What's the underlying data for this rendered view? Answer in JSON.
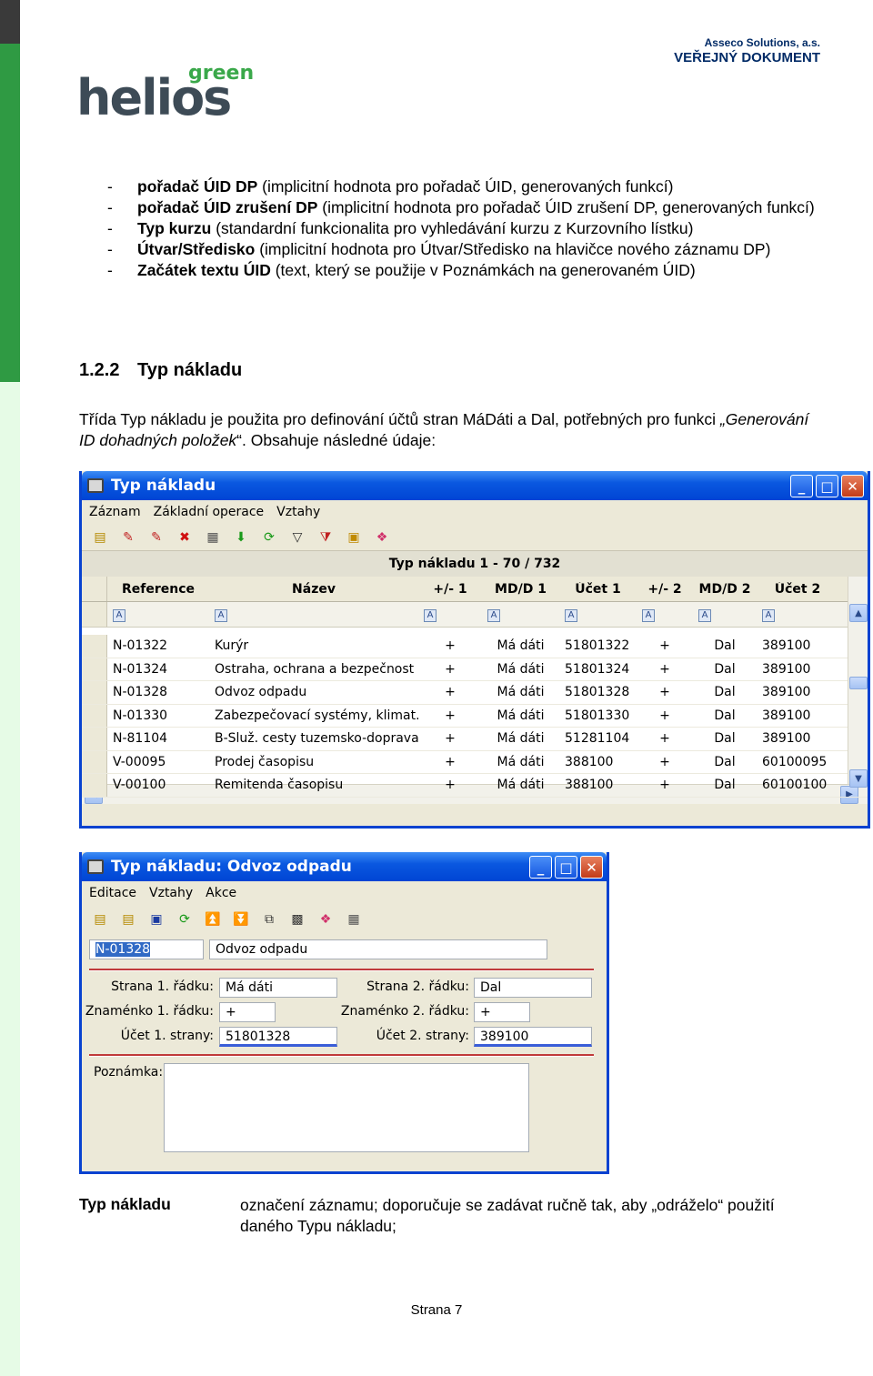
{
  "header": {
    "company": "Asseco Solutions, a.s.",
    "doc_type": "VEŘEJNÝ DOKUMENT",
    "logo_green": "green",
    "logo_main": "helios"
  },
  "bullets": [
    {
      "bold": "pořadač ÚID DP",
      "text": " (implicitní hodnota pro pořadač ÚID, generovaných funkcí)"
    },
    {
      "bold": "pořadač ÚID zrušení DP",
      "text": " (implicitní hodnota pro pořadač ÚID zrušení DP, generovaných funkcí)"
    },
    {
      "bold": "Typ kurzu",
      "text": " (standardní funkcionalita pro vyhledávání kurzu z Kurzovního lístku)"
    },
    {
      "bold": "Útvar/Středisko",
      "text": " (implicitní hodnota pro Útvar/Středisko na hlavičce nového záznamu DP)"
    },
    {
      "bold": "Začátek textu ÚID",
      "text": " (text, který se použije v Poznámkách na generovaném ÚID)"
    }
  ],
  "section": {
    "number": "1.2.2",
    "title": "Typ nákladu"
  },
  "paragraph": {
    "part1": "Třída Typ nákladu je použita pro definování účtů stran MáDáti a Dal, potřebných pro funkci ",
    "italic": "„Generování ID dohadných položek",
    "part2": "“. Obsahuje následné údaje:"
  },
  "list_window": {
    "title": "Typ nákladu",
    "menu": [
      "Záznam",
      "Základní operace",
      "Vztahy"
    ],
    "caption": "Typ nákladu  1 - 70 / 732",
    "columns": [
      "Reference",
      "Název",
      "+/- 1",
      "MD/D 1",
      "Účet 1",
      "+/- 2",
      "MD/D 2",
      "Účet 2"
    ],
    "rows": [
      [
        "N-01322",
        "Kurýr",
        "+",
        "Má dáti",
        "51801322",
        "+",
        "Dal",
        "389100"
      ],
      [
        "N-01324",
        "Ostraha, ochrana a bezpečnost",
        "+",
        "Má dáti",
        "51801324",
        "+",
        "Dal",
        "389100"
      ],
      [
        "N-01328",
        "Odvoz odpadu",
        "+",
        "Má dáti",
        "51801328",
        "+",
        "Dal",
        "389100"
      ],
      [
        "N-01330",
        "Zabezpečovací  systémy, klimat...",
        "+",
        "Má dáti",
        "51801330",
        "+",
        "Dal",
        "389100"
      ],
      [
        "N-81104",
        "B-Služ. cesty tuzemsko-doprava",
        "+",
        "Má dáti",
        "51281104",
        "+",
        "Dal",
        "389100"
      ],
      [
        "V-00095",
        "Prodej časopisu",
        "+",
        "Má dáti",
        "388100",
        "+",
        "Dal",
        "60100095"
      ],
      [
        "V-00100",
        "Remitenda časopisu",
        "+",
        "Má dáti",
        "388100",
        "+",
        "Dal",
        "60100100"
      ]
    ]
  },
  "detail_window": {
    "title": "Typ nákladu: Odvoz odpadu",
    "menu": [
      "Editace",
      "Vztahy",
      "Akce"
    ],
    "reference": "N-01328",
    "name": "Odvoz odpadu",
    "labels": {
      "side1": "Strana 1. řádku:",
      "sign1": "Znaménko 1. řádku:",
      "acc1": "Účet 1. strany:",
      "side2": "Strana 2. řádku:",
      "sign2": "Znaménko 2. řádku:",
      "acc2": "Účet 2. strany:",
      "note": "Poznámka:"
    },
    "values": {
      "side1": "Má dáti",
      "sign1": "+",
      "acc1": "51801328",
      "side2": "Dal",
      "sign2": "+",
      "acc2": "389100",
      "note": ""
    }
  },
  "definition": {
    "term": "Typ nákladu",
    "text": "označení záznamu; doporučuje se zadávat ručně tak, aby „odráželo“ použití daného Typu nákladu;"
  },
  "footer": {
    "page": "Strana 7"
  }
}
